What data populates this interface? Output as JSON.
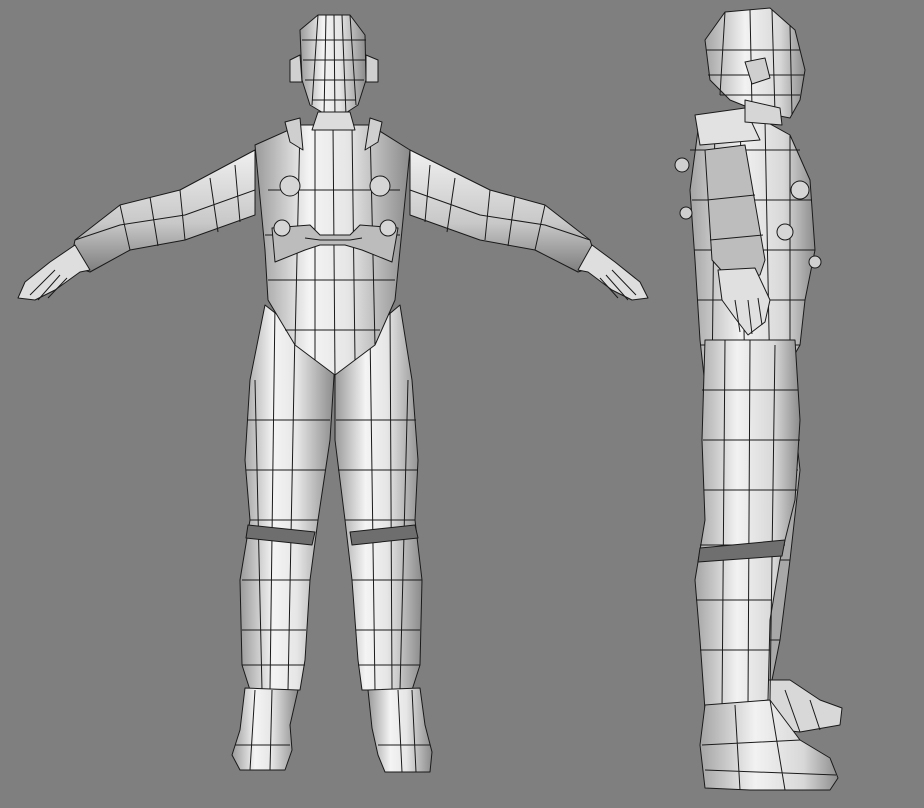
{
  "scene": {
    "background_color": "#7f7f7f",
    "mesh_fill_light": "#ffffff",
    "mesh_fill_mid": "#cfcfcf",
    "mesh_fill_dark": "#8e8e8e",
    "wire_color": "#1a1a1a",
    "views": [
      {
        "name": "front-view"
      },
      {
        "name": "side-view"
      }
    ]
  }
}
